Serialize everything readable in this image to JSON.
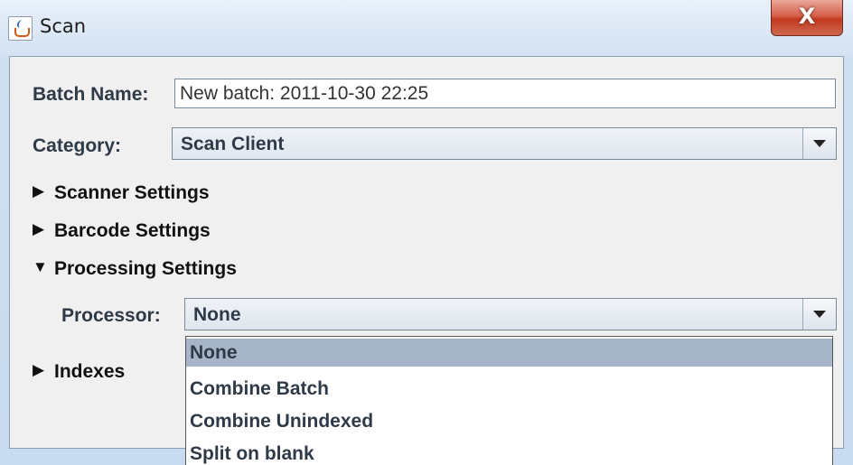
{
  "window": {
    "title": "Scan",
    "close_label": "X"
  },
  "form": {
    "batch_name_label": "Batch Name:",
    "batch_name_value": "New batch: 2011-10-30 22:25",
    "category_label": "Category:",
    "category_value": "Scan Client"
  },
  "sections": {
    "scanner": "Scanner Settings",
    "barcode": "Barcode Settings",
    "processing": "Processing Settings",
    "indexes": "Indexes"
  },
  "processing": {
    "processor_label": "Processor:",
    "processor_value": "None",
    "options": [
      "None",
      "Combine Batch",
      "Combine Unindexed",
      "Split on blank"
    ]
  },
  "icons": {
    "collapsed": "▶",
    "expanded": "▼"
  }
}
